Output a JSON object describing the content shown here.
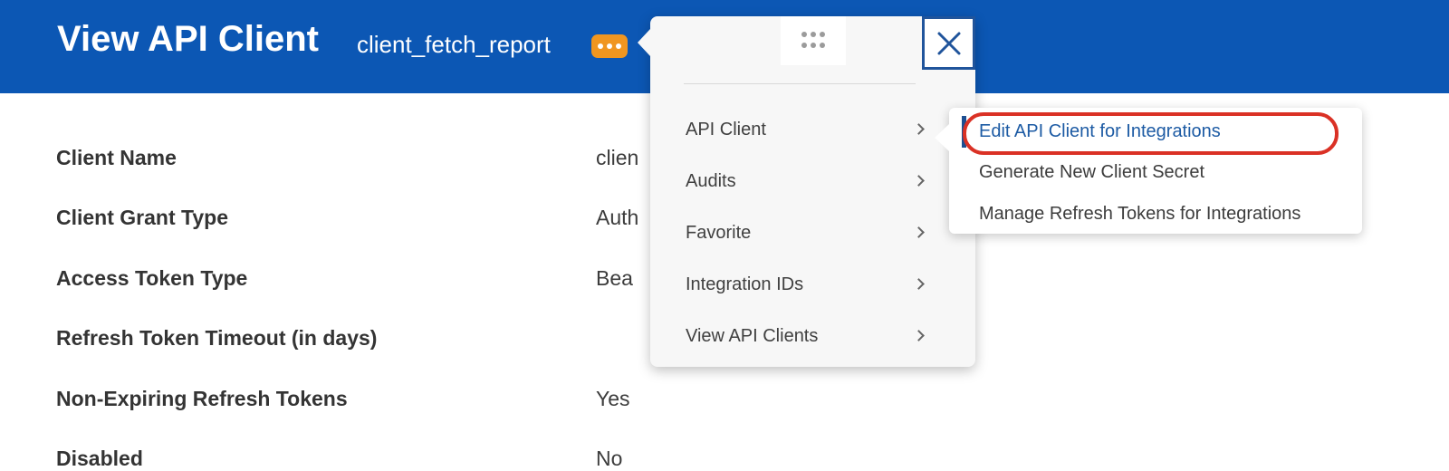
{
  "header": {
    "title": "View API Client",
    "object_name": "client_fetch_report"
  },
  "popup": {
    "menu_items": [
      {
        "label": "API Client"
      },
      {
        "label": "Audits"
      },
      {
        "label": "Favorite"
      },
      {
        "label": "Integration IDs"
      },
      {
        "label": "View API Clients"
      }
    ]
  },
  "submenu": {
    "items": [
      {
        "label": "Edit API Client for Integrations",
        "highlighted": true
      },
      {
        "label": "Generate New Client Secret",
        "highlighted": false
      },
      {
        "label": "Manage Refresh Tokens for Integrations",
        "highlighted": false
      }
    ]
  },
  "fields": [
    {
      "label": "Client Name",
      "value": "clien"
    },
    {
      "label": "Client Grant Type",
      "value": "Auth"
    },
    {
      "label": "Access Token Type",
      "value": "Bea"
    },
    {
      "label": "Refresh Token Timeout (in days)",
      "value": ""
    },
    {
      "label": "Non-Expiring Refresh Tokens",
      "value": "Yes"
    },
    {
      "label": "Disabled",
      "value": "No"
    }
  ],
  "colors": {
    "header_bg": "#0c57b4",
    "accent_orange": "#f09620",
    "link_blue": "#1d5ba4",
    "sel_bar_blue": "#1d4f91",
    "blue_accent": "#20549b",
    "highlight_red": "#da3125"
  }
}
